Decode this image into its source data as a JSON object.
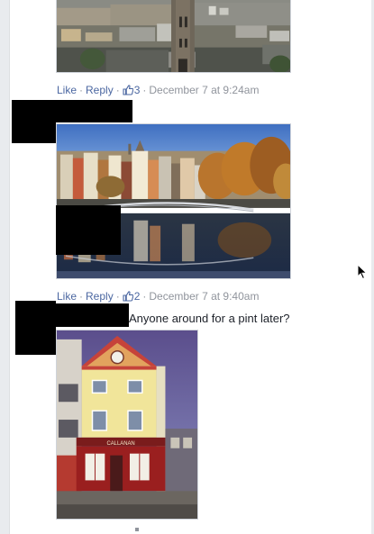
{
  "comments": [
    {
      "like_label": "Like",
      "reply_label": "Reply",
      "like_count": "3",
      "timestamp": "December 7 at 9:24am"
    },
    {
      "like_label": "Like",
      "reply_label": "Reply",
      "like_count": "2",
      "timestamp": "December 7 at 9:40am"
    },
    {
      "text": "Anyone around for a pint later?"
    }
  ],
  "separator": "·",
  "pub_sign": "CALLANAN",
  "icons": {
    "like": "thumbs-up-icon",
    "cursor": "mouse-pointer-icon"
  },
  "colors": {
    "link": "#4b67a1",
    "meta": "#90949c",
    "text": "#1d2129",
    "redaction": "#000000"
  }
}
